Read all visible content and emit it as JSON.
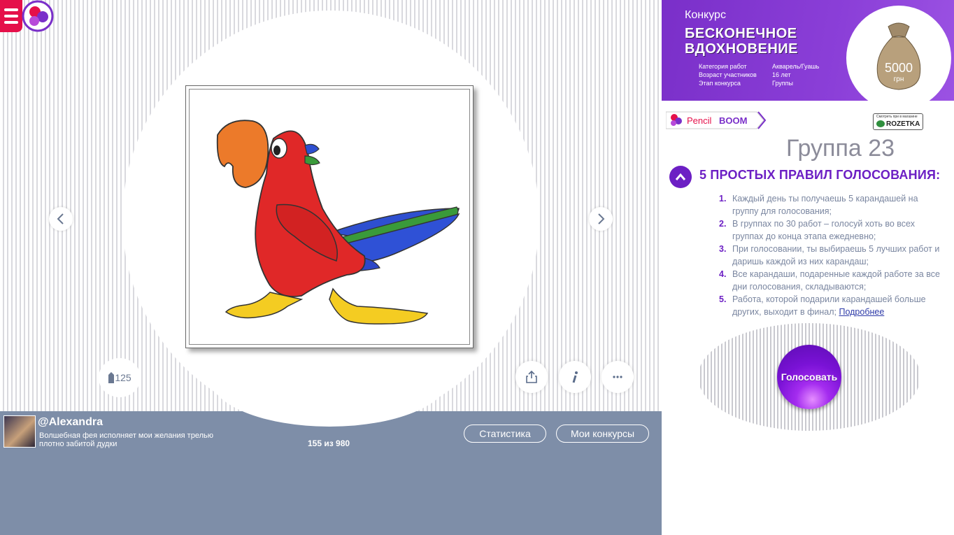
{
  "colors": {
    "accent": "#6c1fc4",
    "author_bar": "#7e8ea8",
    "menu": "#e5104a",
    "banner": "#8b3fd8"
  },
  "stage": {
    "pencil_count": "125",
    "icons": {
      "prev": "chevron-left-icon",
      "next": "chevron-right-icon",
      "share": "share-icon",
      "info": "info-icon",
      "more": "more-icon",
      "pencil": "pencil-icon"
    }
  },
  "author": {
    "name": "@Alexandra",
    "description": "Волшебная фея исполняет мои желания трелью плотно забитой дудки",
    "rank": "155 из 980",
    "stats_label": "Статистика",
    "contests_label": "Мои конкурсы"
  },
  "banner": {
    "small_title": "Конкурс",
    "title_line1": "БЕСКОНЕЧНОЕ",
    "title_line2": "ВДОХНОВЕНИЕ",
    "info": [
      {
        "key": "Категория работ",
        "value": "Акварель/Гуашь"
      },
      {
        "key": "Возраст участников",
        "value": "16 лет"
      },
      {
        "key": "Этап конкурса",
        "value": "Группы"
      }
    ],
    "prize_amount": "5000",
    "prize_currency": "грн"
  },
  "sponsor": {
    "brand_pencil": "Pencil",
    "brand_boom": "BOOM",
    "rozetka_small": "Смотреть при в магазине",
    "rozetka_name": "ROZETKA"
  },
  "group_title": "Группа 23",
  "rules": {
    "title": "5 ПРОСТЫХ ПРАВИЛ ГОЛОСОВАНИЯ:",
    "items": [
      {
        "num": "1.",
        "text": "Каждый день ты получаешь 5 карандашей на группу для голосования;"
      },
      {
        "num": "2.",
        "text": "В группах по 30 работ – голосуй хоть во всех группах до конца этапа ежедневно;"
      },
      {
        "num": "3.",
        "text": "При голосовании, ты выбираешь 5 лучших работ и даришь каждой из них карандаш;"
      },
      {
        "num": "4.",
        "text": "Все карандаши, подаренные каждой работе за все дни голосования, складываются;"
      },
      {
        "num": "5.",
        "text": "Работа, которой подарили карандашей больше других, выходит в финал; "
      }
    ],
    "more_link": "Подробнее"
  },
  "vote_label": "Голосовать"
}
